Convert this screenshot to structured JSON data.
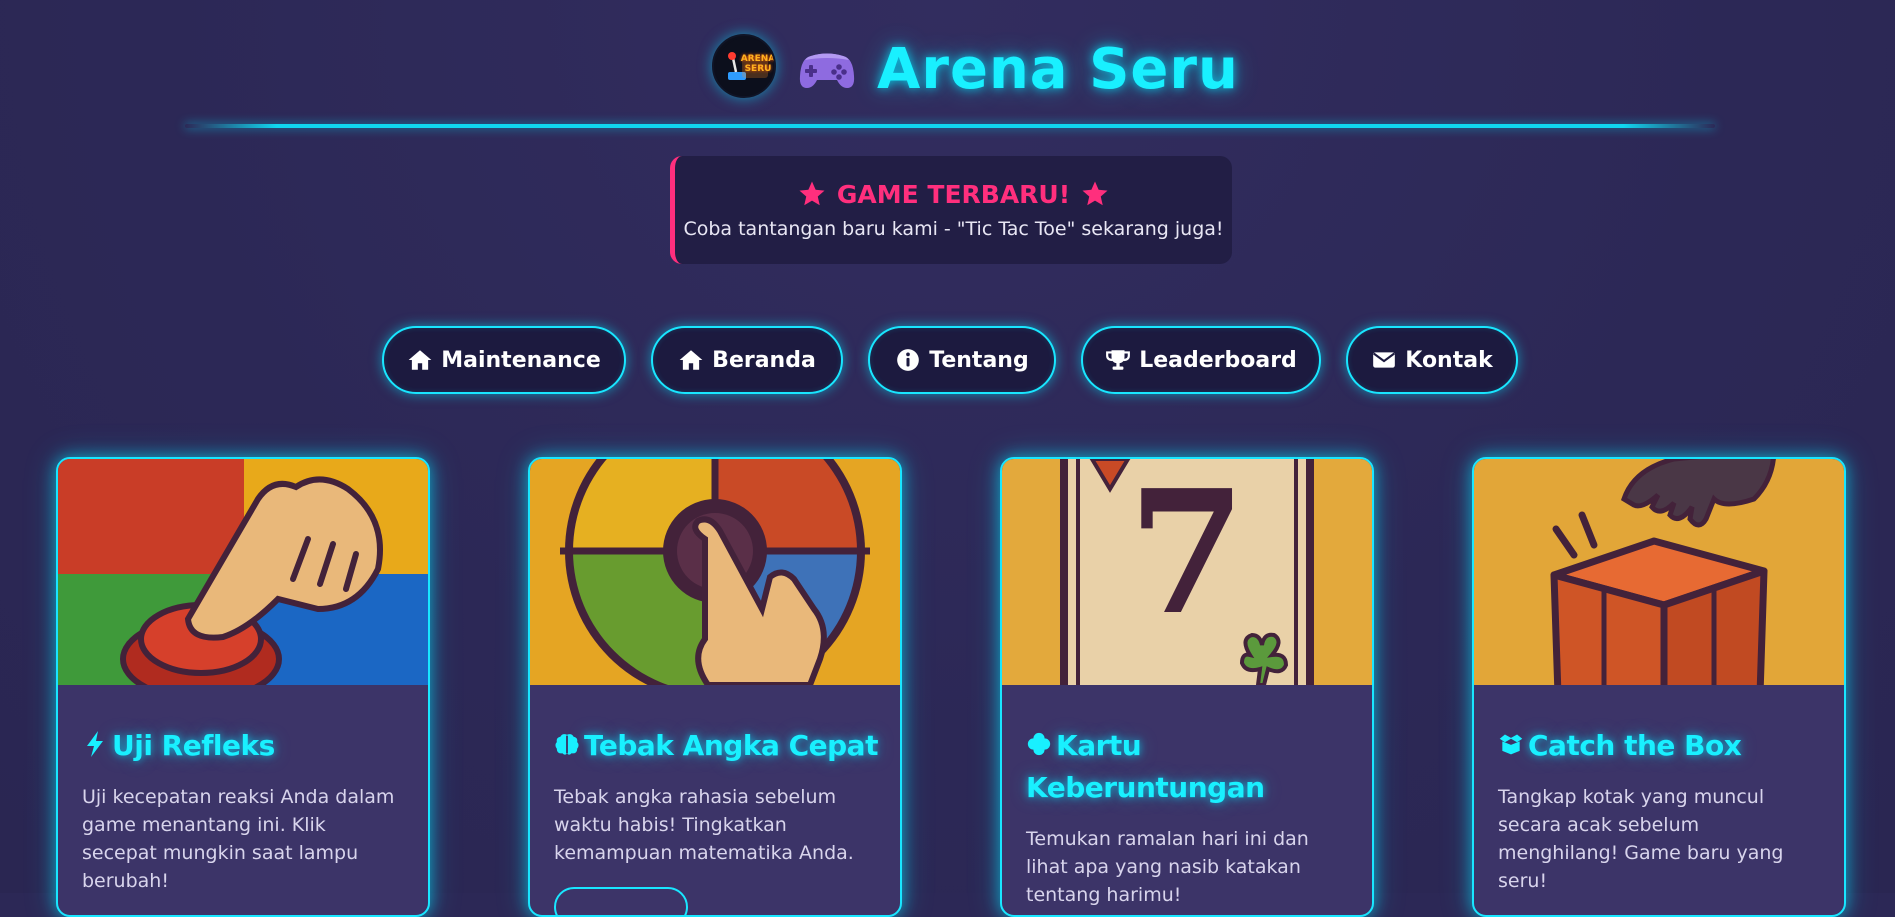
{
  "header": {
    "logo_text": "ARENA SERU",
    "title_emoji": "🎮",
    "title": "Arena Seru"
  },
  "announcement": {
    "title": "GAME TERBARU!",
    "icon": "star-icon",
    "text": "Coba tantangan baru kami - \"Tic Tac Toe\" sekarang juga!"
  },
  "nav": {
    "items": [
      {
        "label": "Maintenance",
        "icon": "home-icon"
      },
      {
        "label": "Beranda",
        "icon": "home-icon"
      },
      {
        "label": "Tentang",
        "icon": "info-icon"
      },
      {
        "label": "Leaderboard",
        "icon": "trophy-icon"
      },
      {
        "label": "Kontak",
        "icon": "envelope-icon"
      }
    ]
  },
  "cards": [
    {
      "title": "Uji Refleks",
      "icon": "bolt-icon",
      "description": "Uji kecepatan reaksi Anda dalam game menantang ini. Klik secepat mungkin saat lampu berubah!"
    },
    {
      "title": "Tebak Angka Cepat",
      "icon": "brain-icon",
      "description": "Tebak angka rahasia sebelum waktu habis! Tingkatkan kemampuan matematika Anda."
    },
    {
      "title": "Kartu Keberuntungan",
      "icon": "clover-icon",
      "description": "Temukan ramalan hari ini dan lihat apa yang nasib katakan tentang harimu!",
      "card_number": "7"
    },
    {
      "title": "Catch the Box",
      "icon": "box-open-icon",
      "description": "Tangkap kotak yang muncul secara acak sebelum menghilang! Game baru yang seru!"
    }
  ],
  "colors": {
    "background": "#2c2856",
    "accent_cyan": "#19f0ff",
    "accent_pink": "#ff2f7d",
    "card_bg": "#3c3468"
  }
}
